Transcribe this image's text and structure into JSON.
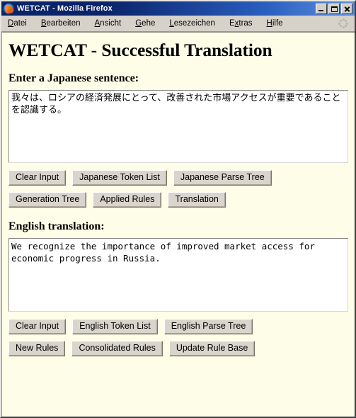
{
  "window": {
    "title": "WETCAT - Mozilla Firefox",
    "app_icon": "firefox-icon",
    "controls": {
      "minimize": "minimize-button",
      "maximize": "maximize-button",
      "close": "close-button"
    }
  },
  "menubar": {
    "items": [
      {
        "label": "Datei",
        "accel": "D"
      },
      {
        "label": "Bearbeiten",
        "accel": "B"
      },
      {
        "label": "Ansicht",
        "accel": "A"
      },
      {
        "label": "Gehe",
        "accel": "G"
      },
      {
        "label": "Lesezeichen",
        "accel": "L"
      },
      {
        "label": "Extras",
        "accel": "x"
      },
      {
        "label": "Hilfe",
        "accel": "H"
      }
    ],
    "throbber": "throbber-icon"
  },
  "page": {
    "title": "WETCAT - Successful Translation",
    "japanese_section": {
      "heading": "Enter a Japanese sentence:",
      "textarea_value": "我々は、ロシアの経済発展にとって、改善された市場アクセスが重要であることを認識する。",
      "textarea_placeholder": ""
    },
    "japanese_buttons_row1": [
      "Clear Input",
      "Japanese Token List",
      "Japanese Parse Tree"
    ],
    "japanese_buttons_row2": [
      "Generation Tree",
      "Applied Rules",
      "Translation"
    ],
    "english_section": {
      "heading": "English translation:",
      "textarea_value": "We recognize the importance of improved market access for economic progress in Russia.",
      "textarea_placeholder": ""
    },
    "english_buttons_row1": [
      "Clear Input",
      "English Token List",
      "English Parse Tree"
    ],
    "english_buttons_row2": [
      "New Rules",
      "Consolidated Rules",
      "Update Rule Base"
    ]
  },
  "colors": {
    "titlebar_start": "#0a246a",
    "titlebar_end": "#5e90de",
    "window_chrome": "#d4d0c8",
    "page_background": "#fdfde8",
    "textarea_background": "#ffffff",
    "button_face": "#d9d5cc",
    "text": "#000000"
  }
}
